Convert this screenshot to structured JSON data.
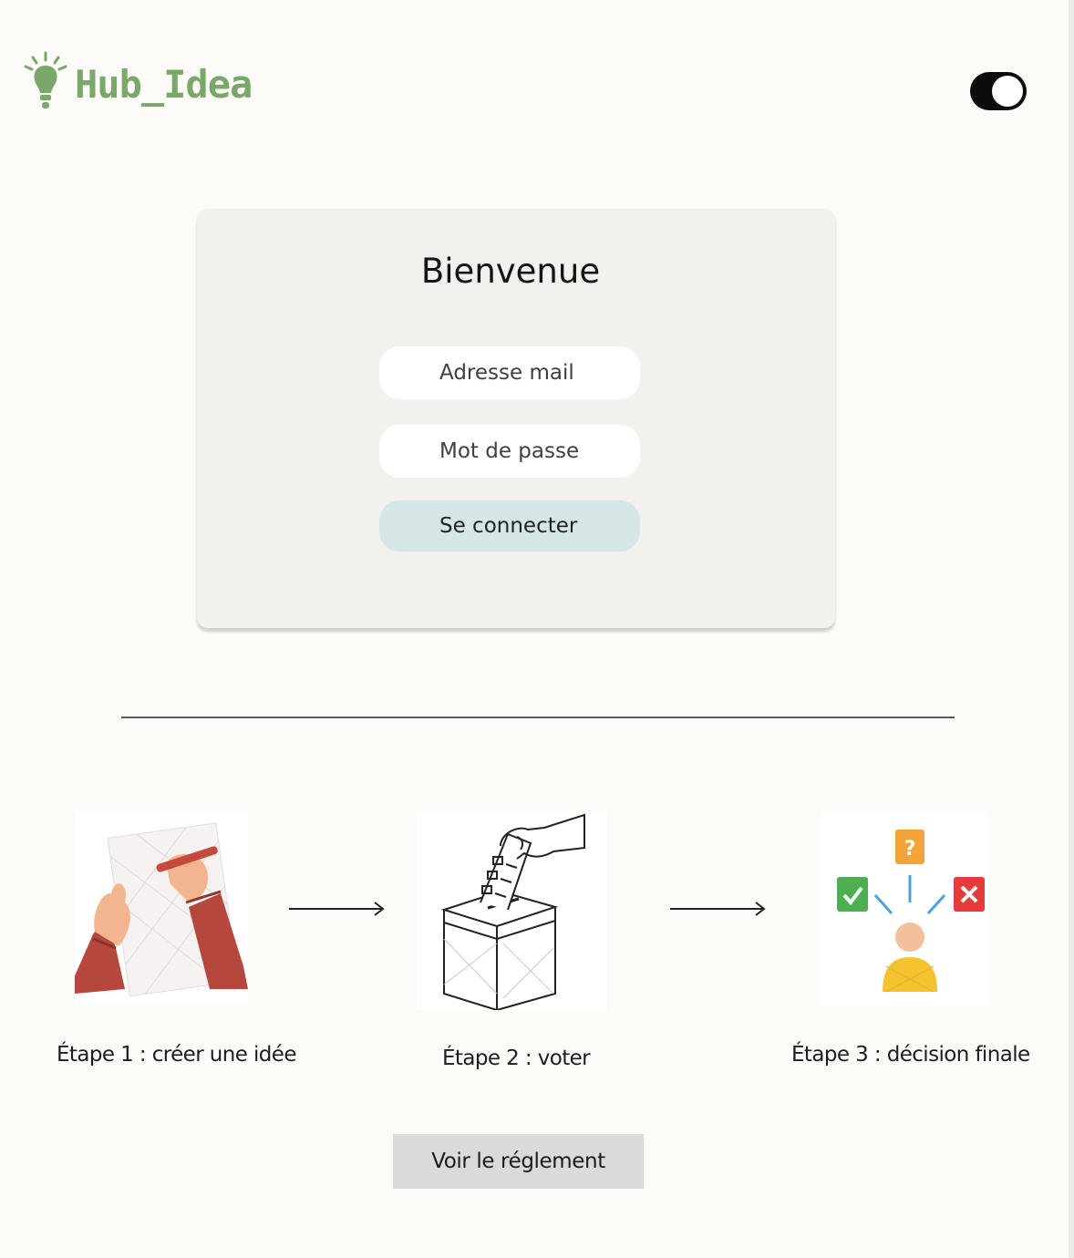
{
  "header": {
    "app_name": "Hub_Idea",
    "logo_icon": "lightbulb-icon",
    "theme_toggle": {
      "icon": "toggle-icon",
      "state": "on"
    }
  },
  "login": {
    "title": "Bienvenue",
    "email_placeholder": "Adresse mail",
    "password_placeholder": "Mot de passe",
    "submit_label": "Se connecter"
  },
  "steps": [
    {
      "caption": "Étape 1 : créer une idée",
      "illustration": "writing-idea-illustration"
    },
    {
      "caption": "Étape 2 : voter",
      "illustration": "ballot-box-illustration"
    },
    {
      "caption": "Étape 3 : décision finale",
      "illustration": "decision-illustration"
    }
  ],
  "rules_button": "Voir le réglement",
  "colors": {
    "background": "#fcfbf7",
    "brand_green": "#7aa86a",
    "card": "#f2f1ed",
    "primary_button": "#d6e6e6",
    "secondary_button": "#dadada"
  }
}
